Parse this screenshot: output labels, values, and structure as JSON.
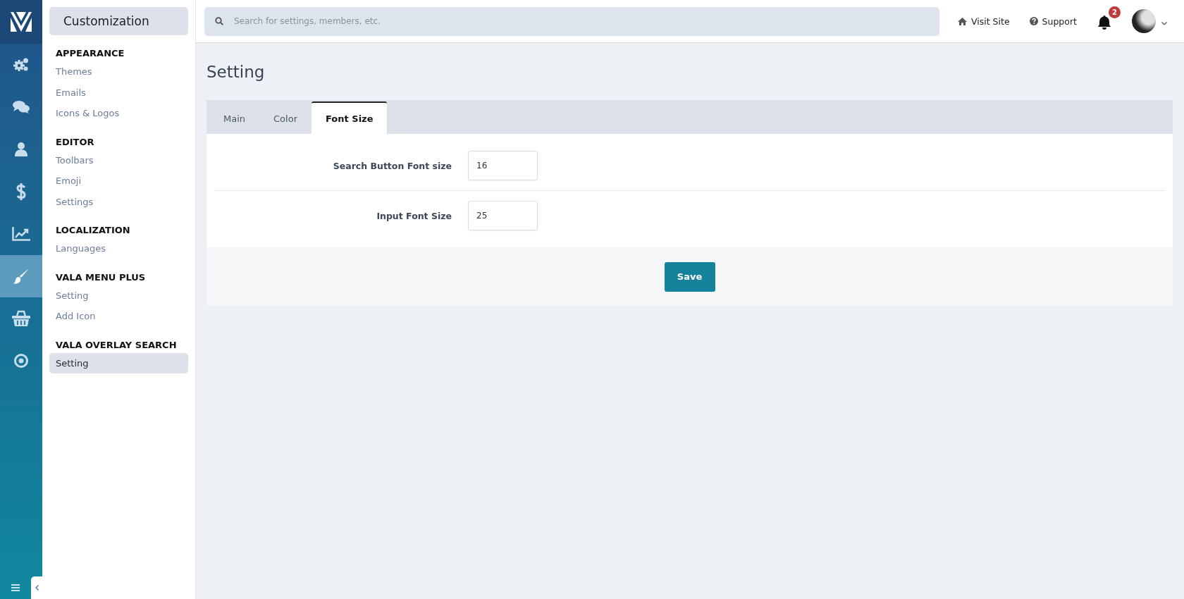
{
  "rail": {
    "items": [
      {
        "kind": "gears",
        "selected": false
      },
      {
        "kind": "chat",
        "selected": false
      },
      {
        "kind": "user",
        "selected": false
      },
      {
        "kind": "dollar",
        "selected": false
      },
      {
        "kind": "chart",
        "selected": false
      },
      {
        "kind": "brush",
        "selected": true
      },
      {
        "kind": "basket",
        "selected": false
      },
      {
        "kind": "target",
        "selected": false
      }
    ]
  },
  "sidebar": {
    "title": "Customization",
    "sections": [
      {
        "heading": "APPEARANCE",
        "items": [
          {
            "label": "Themes",
            "selected": false
          },
          {
            "label": "Emails",
            "selected": false
          },
          {
            "label": "Icons & Logos",
            "selected": false
          }
        ]
      },
      {
        "heading": "EDITOR",
        "items": [
          {
            "label": "Toolbars",
            "selected": false
          },
          {
            "label": "Emoji",
            "selected": false
          },
          {
            "label": "Settings",
            "selected": false
          }
        ]
      },
      {
        "heading": "LOCALIZATION",
        "items": [
          {
            "label": "Languages",
            "selected": false
          }
        ]
      },
      {
        "heading": "VALA MENU PLUS",
        "items": [
          {
            "label": "Setting",
            "selected": false
          },
          {
            "label": "Add Icon",
            "selected": false
          }
        ]
      },
      {
        "heading": "VALA OVERLAY SEARCH",
        "items": [
          {
            "label": "Setting",
            "selected": true
          }
        ]
      }
    ]
  },
  "topbar": {
    "search": {
      "placeholder": "Search for settings, members, etc."
    },
    "links": [
      {
        "kind": "home",
        "label": "Visit Site"
      },
      {
        "kind": "help",
        "label": "Support"
      }
    ],
    "notifications": {
      "count": "2"
    }
  },
  "page": {
    "title": "Setting",
    "tabs": [
      {
        "label": "Main",
        "selected": false
      },
      {
        "label": "Color",
        "selected": false
      },
      {
        "label": "Font Size",
        "selected": true
      }
    ],
    "fields": [
      {
        "label": "Search Button Font size",
        "value": "16"
      },
      {
        "label": "Input Font Size",
        "value": "25"
      }
    ],
    "save_button": "Save"
  }
}
